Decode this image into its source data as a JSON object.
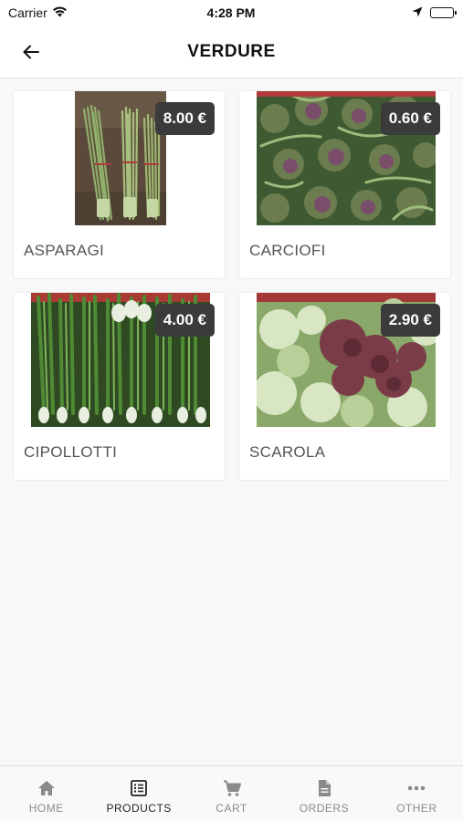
{
  "status_bar": {
    "carrier": "Carrier",
    "time": "4:28 PM"
  },
  "header": {
    "title": "VERDURE"
  },
  "products": [
    {
      "name": "ASPARAGI",
      "price": "8.00 €",
      "photo": "asparagus-photo"
    },
    {
      "name": "CARCIOFI",
      "price": "0.60 €",
      "photo": "artichokes-photo"
    },
    {
      "name": "CIPOLLOTTI",
      "price": "4.00 €",
      "photo": "spring-onions-photo"
    },
    {
      "name": "SCAROLA",
      "price": "2.90 €",
      "photo": "escarole-photo"
    }
  ],
  "tabbar": {
    "items": [
      {
        "label": "HOME",
        "icon": "home-icon"
      },
      {
        "label": "PRODUCTS",
        "icon": "list-icon",
        "active": true
      },
      {
        "label": "CART",
        "icon": "cart-icon"
      },
      {
        "label": "ORDERS",
        "icon": "document-icon"
      },
      {
        "label": "OTHER",
        "icon": "more-icon"
      }
    ]
  },
  "colors": {
    "accent": "#222222",
    "badge": "#3b3b3b",
    "inactive_tab": "#8a8a8a"
  }
}
